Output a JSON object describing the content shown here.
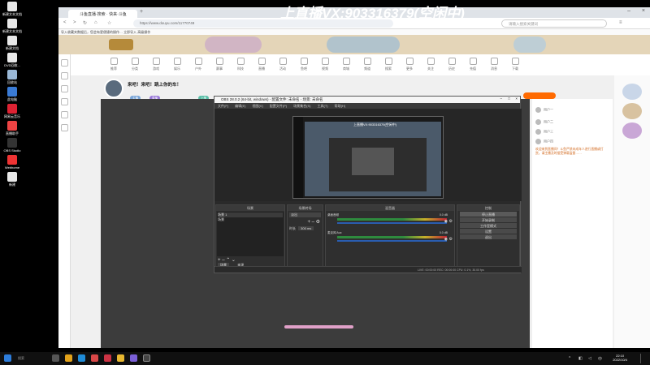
{
  "overlay": {
    "title": "上直播VX:903316379(空闲中)"
  },
  "desktop": {
    "icons": [
      {
        "label": "新建文本文档",
        "color": "#e8e8e8"
      },
      {
        "label": "新建文本文档",
        "color": "#e8e8e8"
      },
      {
        "label": "新建文档",
        "color": "#e8e8e8"
      },
      {
        "label": "DVD回收...",
        "color": "#e8e8e8"
      },
      {
        "label": "回收站",
        "color": "#9ab8d6"
      },
      {
        "label": "此电脑",
        "color": "#3a7bd5"
      },
      {
        "label": "网易云音乐",
        "color": "#d23"
      },
      {
        "label": "直播助手",
        "color": "#e44"
      },
      {
        "label": "OBS Studio",
        "color": "#333"
      },
      {
        "label": "Webhome",
        "color": "#e33"
      },
      {
        "label": "新建",
        "color": "#e8e8e8"
      }
    ]
  },
  "browser": {
    "tab_title": "斗鱼直播·搜索 · 快来·斗鱼",
    "url": "https://www.douyu.com/11770749",
    "search_placeholder": "请输入搜索关键词",
    "bookmarks": "导入收藏夹数据后，您会有更便捷的操作…  立即导入  高级操作",
    "categories": [
      "推荐",
      "分类",
      "游戏",
      "娱乐",
      "户外",
      "赛事",
      "科技",
      "直播",
      "活动",
      "鱼吧",
      "视频",
      "商城",
      "频道",
      "搜索",
      "更多",
      "关注",
      "历史",
      "充值",
      "消息",
      "下载"
    ],
    "room": {
      "title": "来吧！来吧！跳上你的车！",
      "tags": [
        "主播",
        "直播",
        "上神",
        "视频"
      ]
    },
    "chat": [
      "用户一",
      "用户二",
      "用户三",
      "用户四"
    ],
    "notice": "欢迎来到直播间！斗鱼严禁未成年人进行直播或打赏，请主播及时接受弹幕监督……"
  },
  "obs": {
    "title": "OBS 28.0.2 (64-bit, windows) - 配置文件: 未命名 - 场景: 未命名",
    "menu": [
      "文件(F)",
      "编辑(E)",
      "视图(V)",
      "配置文件(P)",
      "场景集合(S)",
      "工具(T)",
      "帮助(H)"
    ],
    "preview_caption": "上直播VX:903316379(空闲中)",
    "docks": {
      "scenes": {
        "title": "场景",
        "items": [
          "场景 1",
          "场景"
        ]
      },
      "sources": {
        "title": "来源",
        "items": [
          "图层"
        ]
      },
      "mixer": {
        "title": "混音器",
        "tracks": [
          {
            "label": "桌面音频",
            "db": "0.0 dB"
          },
          {
            "label": "麦克风/Aux",
            "db": "0.0 dB"
          }
        ]
      },
      "transitions": {
        "title": "场景转场",
        "type": "淡出",
        "duration_label": "时长",
        "duration": "300 ms"
      },
      "controls": {
        "title": "控制",
        "buttons": [
          "停止直播",
          "开始录制",
          "工作室模式",
          "设置",
          "退出"
        ]
      }
    },
    "status": "LIVE: 00:00:00    REC: 00:00:00    CPU: 0.1%, 30.00 fps"
  },
  "taskbar": {
    "search_label": "搜索",
    "time": "22:10",
    "date": "2022/10/4"
  },
  "colors": {
    "banner": "#e4d5b8",
    "player_bg": "#3c3c3c",
    "obs_bg": "#2a2a2a",
    "accent_pink": "#e0a0c8"
  }
}
